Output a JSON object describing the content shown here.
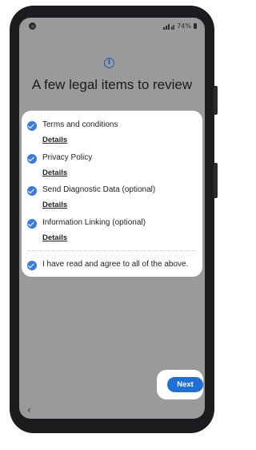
{
  "status_bar": {
    "battery": "74%"
  },
  "header": {
    "title": "A few legal items to review",
    "icon": "info-icon"
  },
  "items": [
    {
      "label": "Terms and conditions",
      "link": "Details",
      "checked": true
    },
    {
      "label": "Privacy Policy",
      "link": "Details",
      "checked": true
    },
    {
      "label": "Send Diagnostic Data (optional)",
      "link": "Details",
      "checked": true
    },
    {
      "label": "Information Linking (optional)",
      "link": "Details",
      "checked": true
    }
  ],
  "agree_all": {
    "label": "I have read and agree to all of the above.",
    "checked": true
  },
  "footer": {
    "next_label": "Next",
    "back_icon": "chevron-left-icon"
  },
  "colors": {
    "accent": "#1f6fd6",
    "check": "#3b7be0",
    "background": "#9a9a9a"
  }
}
